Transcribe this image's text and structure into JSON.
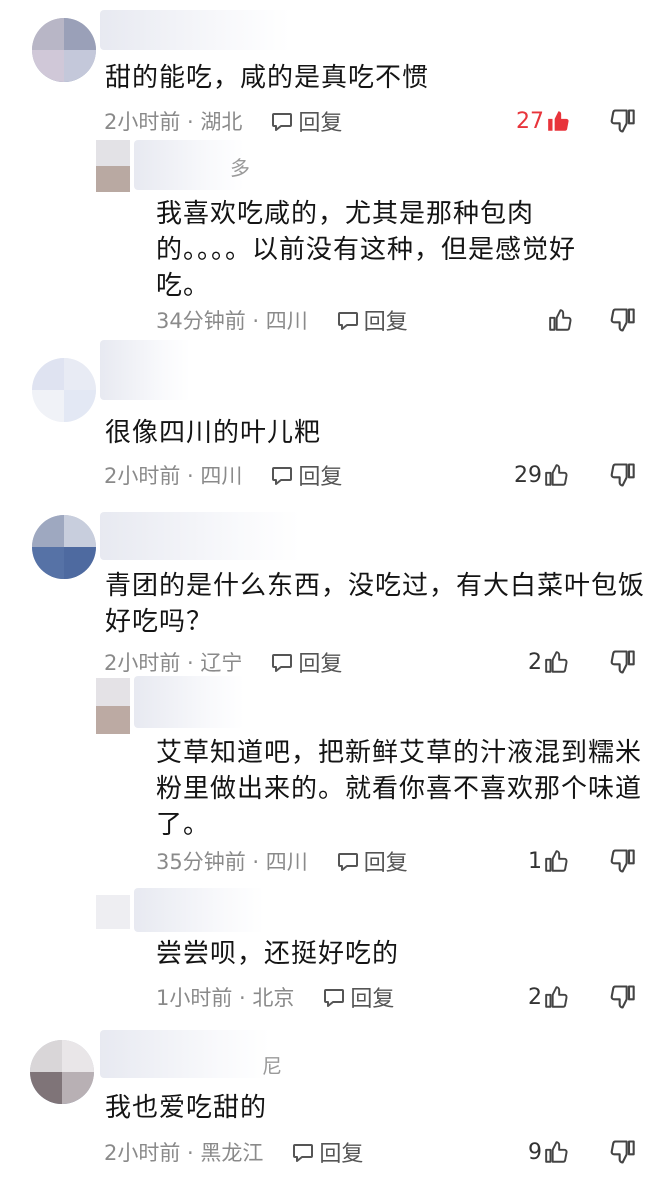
{
  "comments": [
    {
      "text": "甜的能吃，咸的是真吃不惯",
      "time": "2小时前 · 湖北",
      "reply": "回复",
      "likes": "27",
      "liked": true
    },
    {
      "username": "多",
      "text_lines": [
        "我喜欢吃咸的，尤其是那种包肉",
        "的。。。。以前没有这种，但是感觉好",
        "吃。"
      ],
      "time": "34分钟前 · 四川",
      "reply": "回复",
      "likes": ""
    },
    {
      "text": "很像四川的叶儿粑",
      "time": "2小时前 · 四川",
      "reply": "回复",
      "likes": "29"
    },
    {
      "text_lines": [
        "青团的是什么东西，没吃过，有大白菜叶包饭",
        "好吃吗？"
      ],
      "time": "2小时前 · 辽宁",
      "reply": "回复",
      "likes": "2"
    },
    {
      "text_lines": [
        "艾草知道吧，把新鲜艾草的汁液混到糯米",
        "粉里做出来的。就看你喜不喜欢那个味道",
        "了。"
      ],
      "time": "35分钟前 · 四川",
      "reply": "回复",
      "likes": "1"
    },
    {
      "text": "尝尝呗，还挺好吃的",
      "time": "1小时前 · 北京",
      "reply": "回复",
      "likes": "2"
    },
    {
      "username": "尼",
      "text": "我也爱吃甜的",
      "time": "2小时前 · 黑龙江",
      "reply": "回复",
      "likes": "9"
    }
  ],
  "colors": {
    "liked": "#e8343b",
    "meta": "#8a8a8a",
    "text": "#141414"
  },
  "icons": [
    "reply-bubble-icon",
    "thumbs-up-icon",
    "thumbs-down-icon"
  ]
}
